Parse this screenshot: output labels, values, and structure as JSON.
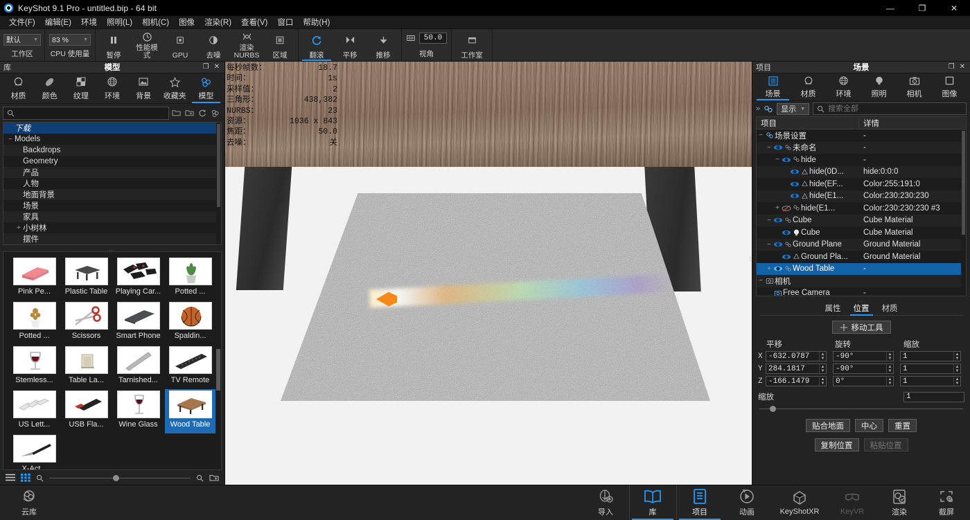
{
  "titlebar": {
    "app_title": "KeyShot 9.1 Pro  - untitled.bip  - 64 bit",
    "minimize": "—",
    "maximize": "❐",
    "close": "✕"
  },
  "menubar": {
    "items": [
      {
        "label": "文件(F)"
      },
      {
        "label": "编辑(E)"
      },
      {
        "label": "环境"
      },
      {
        "label": "照明(L)"
      },
      {
        "label": "相机(C)"
      },
      {
        "label": "图像"
      },
      {
        "label": "渲染(R)"
      },
      {
        "label": "查看(V)"
      },
      {
        "label": "窗口"
      },
      {
        "label": "帮助(H)"
      }
    ]
  },
  "toolbar": {
    "workspace_value": "默认",
    "workspace_label": "工作区",
    "cpu_value": "83 %",
    "cpu_label": "CPU 使用量",
    "buttons": [
      {
        "label": "暂停",
        "icon": "pause-icon"
      },
      {
        "label": "性能模式",
        "icon": "performance-icon"
      },
      {
        "label": "GPU",
        "icon": "gpu-icon"
      },
      {
        "label": "去噪",
        "icon": "denoise-icon"
      },
      {
        "label": "渲染 NURBS",
        "icon": "nurbs-icon"
      },
      {
        "label": "区域",
        "icon": "region-icon"
      },
      {
        "label": "翻滚",
        "icon": "tumble-icon",
        "active": true
      },
      {
        "label": "平移",
        "icon": "pan-icon"
      },
      {
        "label": "推移",
        "icon": "dolly-icon"
      }
    ],
    "fov_value": "50.0",
    "fov_label": "视角",
    "studio_label": "工作室"
  },
  "library": {
    "panel_left_label": "库",
    "panel_title": "模型",
    "float_icon": "❐",
    "close_icon": "✕",
    "tabs": [
      {
        "label": "材质",
        "icon": "material-sphere-icon"
      },
      {
        "label": "颜色",
        "icon": "color-icon"
      },
      {
        "label": "纹理",
        "icon": "texture-icon"
      },
      {
        "label": "环境",
        "icon": "environment-globe-icon"
      },
      {
        "label": "背景",
        "icon": "backplate-icon"
      },
      {
        "label": "收藏夹",
        "icon": "star-icon"
      },
      {
        "label": "模型",
        "icon": "model-icon",
        "active": true
      }
    ],
    "search_placeholder": "",
    "search_value": "",
    "tree": [
      {
        "label": "下载",
        "indent": 1,
        "expander": "",
        "selected": true
      },
      {
        "label": "Models",
        "indent": 0,
        "expander": "−"
      },
      {
        "label": "Backdrops",
        "indent": 1,
        "expander": ""
      },
      {
        "label": "Geometry",
        "indent": 1,
        "expander": ""
      },
      {
        "label": "产品",
        "indent": 1,
        "expander": ""
      },
      {
        "label": "人物",
        "indent": 1,
        "expander": ""
      },
      {
        "label": "地面背景",
        "indent": 1,
        "expander": ""
      },
      {
        "label": "场景",
        "indent": 1,
        "expander": ""
      },
      {
        "label": "家具",
        "indent": 1,
        "expander": ""
      },
      {
        "label": "小树林",
        "indent": 1,
        "expander": "+"
      },
      {
        "label": "摆件",
        "indent": 1,
        "expander": ""
      }
    ],
    "items": [
      {
        "label": "Pink Pe...",
        "thumb": "pink-eraser"
      },
      {
        "label": "Plastic Table",
        "thumb": "plastic-table"
      },
      {
        "label": "Playing Car...",
        "thumb": "playing-cards"
      },
      {
        "label": "Potted ...",
        "thumb": "potted-plant-green"
      },
      {
        "label": "Potted ...",
        "thumb": "potted-plant-dry"
      },
      {
        "label": "Scissors",
        "thumb": "scissors"
      },
      {
        "label": "Smart Phone",
        "thumb": "smart-phone"
      },
      {
        "label": "Spaldin...",
        "thumb": "basketball"
      },
      {
        "label": "Stemless...",
        "thumb": "wine-glass-stemless"
      },
      {
        "label": "Table La...",
        "thumb": "table-lamp"
      },
      {
        "label": "Tarnished...",
        "thumb": "tarnished-ruler"
      },
      {
        "label": "TV Remote",
        "thumb": "tv-remote"
      },
      {
        "label": "US Lett...",
        "thumb": "us-letter-paper"
      },
      {
        "label": "USB Fla...",
        "thumb": "usb-flash"
      },
      {
        "label": "Wine Glass",
        "thumb": "wine-glass"
      },
      {
        "label": "Wood Table",
        "thumb": "wood-table",
        "selected": true
      },
      {
        "label": "X-Act...",
        "thumb": "xacto-knife"
      }
    ]
  },
  "viewport": {
    "stats": [
      {
        "key": "每秒帧数：",
        "value": "18.7"
      },
      {
        "key": "时间：",
        "value": "1s"
      },
      {
        "key": "采样值：",
        "value": "2"
      },
      {
        "key": "三角形：",
        "value": "438,382"
      },
      {
        "key": "NURBS：",
        "value": "23"
      },
      {
        "key": "资源：",
        "value": "1036 x 843"
      },
      {
        "key": "焦距：",
        "value": "50.0"
      },
      {
        "key": "去噪：",
        "value": "关"
      }
    ]
  },
  "project": {
    "panel_left_label": "项目",
    "panel_title": "场景",
    "float_icon": "❐",
    "close_icon": "✕",
    "tabs": [
      {
        "label": "场景",
        "icon": "scene-list-icon",
        "active": true
      },
      {
        "label": "材质",
        "icon": "material-sphere-icon"
      },
      {
        "label": "环境",
        "icon": "environment-globe-icon"
      },
      {
        "label": "照明",
        "icon": "lighting-bulb-icon"
      },
      {
        "label": "相机",
        "icon": "camera-icon"
      },
      {
        "label": "图像",
        "icon": "image-frame-icon"
      }
    ],
    "show_button": "显示",
    "search_placeholder": "搜索全部",
    "search_value": "",
    "tree_columns": [
      "项目",
      "详情"
    ],
    "tree_rows": [
      {
        "name": "场景设置",
        "detail": "-",
        "indent": 0,
        "expander": "−",
        "eye": false,
        "icon": "scene-root-icon"
      },
      {
        "name": "未命名",
        "detail": "-",
        "indent": 1,
        "expander": "−",
        "eye": true,
        "eye_style": "partial",
        "icon": "group-icon"
      },
      {
        "name": "hide",
        "detail": "-",
        "indent": 2,
        "expander": "−",
        "eye": true,
        "eye_style": "partial",
        "icon": "group-icon"
      },
      {
        "name": "hide(0D...",
        "detail": "hide:0:0:0",
        "indent": 3,
        "expander": "",
        "eye": true,
        "icon": "part-icon"
      },
      {
        "name": "hide(EF...",
        "detail": "Color:255:191:0",
        "indent": 3,
        "expander": "",
        "eye": true,
        "icon": "part-icon"
      },
      {
        "name": "hide(E1...",
        "detail": "Color:230:230:230",
        "indent": 3,
        "expander": "",
        "eye": true,
        "icon": "part-icon"
      },
      {
        "name": "hide(E1...",
        "detail": "Color:230:230:230 #3",
        "indent": 2,
        "expander": "+",
        "eye": true,
        "eye_style": "hidden",
        "icon": "group-icon"
      },
      {
        "name": "Cube",
        "detail": "Cube Material",
        "indent": 1,
        "expander": "−",
        "eye": true,
        "icon": "group-icon"
      },
      {
        "name": "Cube",
        "detail": "Cube Material",
        "indent": 2,
        "expander": "",
        "eye": true,
        "icon": "light-icon"
      },
      {
        "name": "Ground Plane",
        "detail": "Ground Material",
        "indent": 1,
        "expander": "−",
        "eye": true,
        "icon": "group-icon"
      },
      {
        "name": "Ground Pla...",
        "detail": "Ground Material",
        "indent": 2,
        "expander": "",
        "eye": true,
        "icon": "part-icon"
      },
      {
        "name": "Wood Table",
        "detail": "-",
        "indent": 1,
        "expander": "+",
        "eye": true,
        "icon": "group-icon",
        "selected": true
      },
      {
        "name": "相机",
        "detail": "",
        "indent": 0,
        "expander": "−",
        "eye": false,
        "icon": "camera-icon"
      },
      {
        "name": "Free Camera",
        "detail": "-",
        "indent": 1,
        "expander": "",
        "eye": false,
        "icon": "camera-icon"
      }
    ],
    "subtabs": [
      {
        "label": "属性"
      },
      {
        "label": "位置",
        "active": true
      },
      {
        "label": "材质"
      }
    ],
    "move_tool_label": "移动工具",
    "xform_headers": [
      "平移",
      "旋转",
      "缩放"
    ],
    "xform_rows": [
      {
        "axis": "X",
        "translate": "-632.0787",
        "rotate": "-90°",
        "scale": "1"
      },
      {
        "axis": "Y",
        "translate": "284.1817",
        "rotate": "-90°",
        "scale": "1"
      },
      {
        "axis": "Z",
        "translate": "-166.1479",
        "rotate": "0°",
        "scale": "1"
      }
    ],
    "scale_label": "缩放",
    "scale_value": "1",
    "buttons_row1": [
      {
        "label": "贴合地面"
      },
      {
        "label": "中心"
      },
      {
        "label": "重置"
      }
    ],
    "buttons_row2": [
      {
        "label": "复制位置"
      },
      {
        "label": "粘贴位置",
        "disabled": true
      }
    ]
  },
  "bottombar": {
    "cloud_label": "云库",
    "items": [
      {
        "label": "导入",
        "icon": "import-icon"
      },
      {
        "label": "库",
        "icon": "library-book-icon",
        "active": true
      },
      {
        "label": "项目",
        "icon": "project-list-icon",
        "active": true
      },
      {
        "label": "动画",
        "icon": "animation-icon"
      },
      {
        "label": "KeyShotXR",
        "icon": "keyshotxr-icon"
      },
      {
        "label": "KeyVR",
        "icon": "keyvr-icon",
        "dim": true
      },
      {
        "label": "渲染",
        "icon": "render-icon"
      }
    ],
    "screenshot_label": "截屏"
  },
  "colors": {
    "accent": "#1e9bff",
    "selection": "#1262a8",
    "library_selection": "#0f3f74",
    "panel_bg": "#232323",
    "field_bg": "#1c1c1c"
  }
}
